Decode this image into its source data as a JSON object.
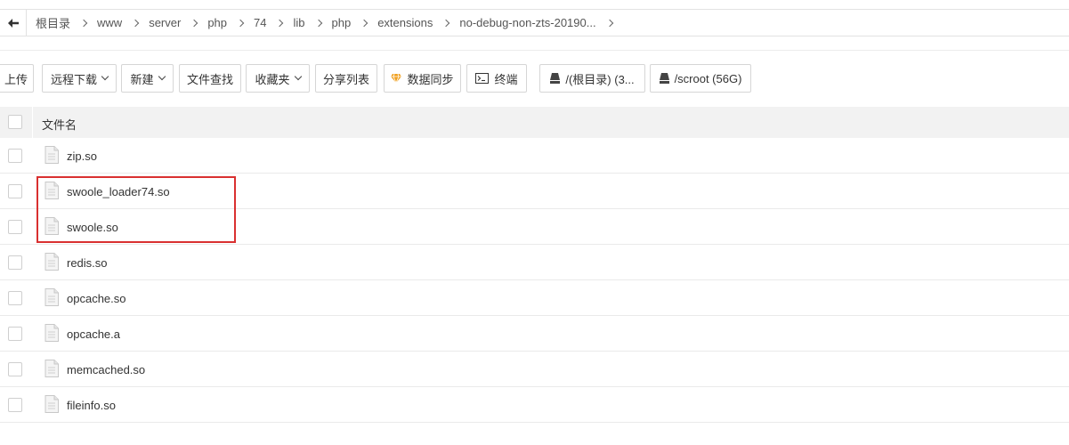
{
  "breadcrumb": {
    "items": [
      "根目录",
      "www",
      "server",
      "php",
      "74",
      "lib",
      "php",
      "extensions",
      "no-debug-non-zts-20190..."
    ]
  },
  "toolbar": {
    "upload": "上传",
    "remote_download": "远程下载",
    "new": "新建",
    "file_search": "文件查找",
    "favorites": "收藏夹",
    "share_list": "分享列表",
    "data_sync": "数据同步",
    "terminal": "终端",
    "disk_root": "/(根目录) (3...",
    "disk_scroot": "/scroot (56G)"
  },
  "table": {
    "header_name": "文件名",
    "files": [
      "zip.so",
      "swoole_loader74.so",
      "swoole.so",
      "redis.so",
      "opcache.so",
      "opcache.a",
      "memcached.so",
      "fileinfo.so"
    ]
  },
  "colors": {
    "highlight": "#d93030",
    "header_bg": "#f2f2f2",
    "sync_icon": "#f0a020"
  }
}
